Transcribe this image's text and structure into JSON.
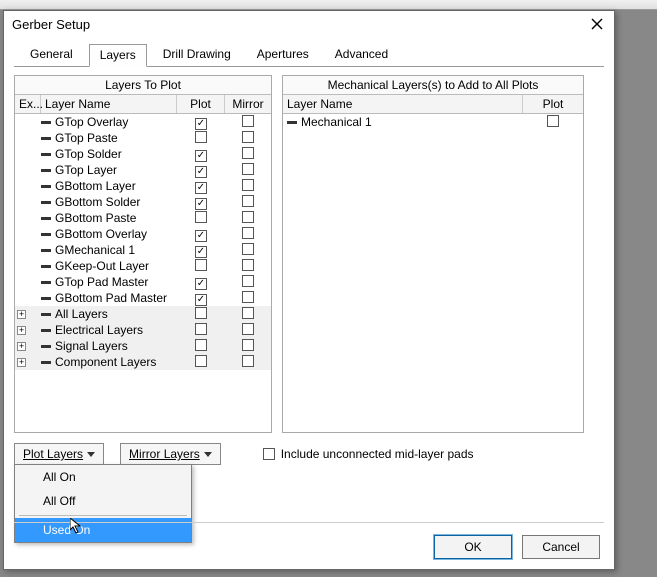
{
  "window": {
    "title": "Gerber Setup"
  },
  "tabs": [
    "General",
    "Layers",
    "Drill Drawing",
    "Apertures",
    "Advanced"
  ],
  "activeTab": 1,
  "leftBox": {
    "title": "Layers To Plot",
    "headers": {
      "ex": "Ex...",
      "name": "Layer Name",
      "plot": "Plot",
      "mirror": "Mirror"
    },
    "rows": [
      {
        "name": "GTop Overlay",
        "plot": true,
        "mirror": false
      },
      {
        "name": "GTop Paste",
        "plot": false,
        "mirror": false
      },
      {
        "name": "GTop Solder",
        "plot": true,
        "mirror": false
      },
      {
        "name": "GTop Layer",
        "plot": true,
        "mirror": false
      },
      {
        "name": "GBottom Layer",
        "plot": true,
        "mirror": false
      },
      {
        "name": "GBottom Solder",
        "plot": true,
        "mirror": false
      },
      {
        "name": "GBottom Paste",
        "plot": false,
        "mirror": false
      },
      {
        "name": "GBottom Overlay",
        "plot": true,
        "mirror": false
      },
      {
        "name": "GMechanical 1",
        "plot": true,
        "mirror": false
      },
      {
        "name": "GKeep-Out Layer",
        "plot": false,
        "mirror": false
      },
      {
        "name": "GTop Pad Master",
        "plot": true,
        "mirror": false
      },
      {
        "name": "GBottom Pad Master",
        "plot": true,
        "mirror": false
      }
    ],
    "groupRows": [
      {
        "name": "All Layers"
      },
      {
        "name": "Electrical Layers"
      },
      {
        "name": "Signal Layers"
      },
      {
        "name": "Component Layers"
      }
    ]
  },
  "rightBox": {
    "title": "Mechanical Layers(s) to Add to All Plots",
    "headers": {
      "name": "Layer Name",
      "plot": "Plot"
    },
    "rows": [
      {
        "name": "Mechanical 1",
        "plot": false
      }
    ]
  },
  "dropdowns": {
    "plotLayers": "Plot Layers",
    "mirrorLayers": "Mirror Layers"
  },
  "midPads": {
    "label": "Include unconnected mid-layer pads",
    "checked": false
  },
  "menu": {
    "items": [
      "All On",
      "All Off",
      "Used On"
    ],
    "selectedIndex": 2
  },
  "buttons": {
    "ok": "OK",
    "cancel": "Cancel"
  }
}
